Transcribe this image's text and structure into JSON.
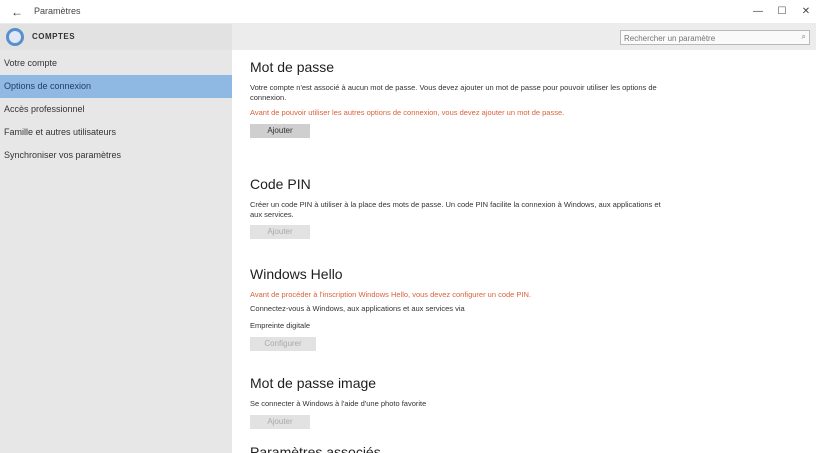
{
  "window": {
    "title": "Paramètres",
    "back_glyph": "←",
    "min_glyph": "—",
    "max_glyph": "☐",
    "close_glyph": "✕"
  },
  "header": {
    "section_title": "COMPTES",
    "icon": "gear-icon",
    "accent_color": "#5a8fcf"
  },
  "search": {
    "placeholder": "Rechercher un paramètre",
    "icon": "search-icon",
    "glyph": "⌕"
  },
  "sidebar": {
    "items": [
      {
        "label": "Votre compte",
        "active": false
      },
      {
        "label": "Options de connexion",
        "active": true
      },
      {
        "label": "Accès professionnel",
        "active": false
      },
      {
        "label": "Famille et autres utilisateurs",
        "active": false
      },
      {
        "label": "Synchroniser vos paramètres",
        "active": false
      }
    ]
  },
  "main": {
    "password": {
      "title": "Mot de passe",
      "text": "Votre compte n'est associé à aucun mot de passe. Vous devez ajouter un mot de passe pour pouvoir utiliser les options de connexion.",
      "warning": "Avant de pouvoir utiliser les autres options de connexion, vous devez ajouter un mot de passe.",
      "button": "Ajouter"
    },
    "pin": {
      "title": "Code PIN",
      "text": "Créer un code PIN à utiliser à la place des mots de passe. Un code PIN facilite la connexion à Windows, aux applications et aux services.",
      "button": "Ajouter"
    },
    "hello": {
      "title": "Windows Hello",
      "warning": "Avant de procéder à l'inscription Windows Hello, vous devez configurer un code PIN.",
      "text": "Connectez-vous à Windows, aux applications et aux services via",
      "sub": "Empreinte digitale",
      "button": "Configurer"
    },
    "picture": {
      "title": "Mot de passe image",
      "text": "Se connecter à Windows à l'aide d'une photo favorite",
      "button": "Ajouter"
    },
    "partial": {
      "title": "Paramètres associés"
    }
  },
  "colors": {
    "sidebar_bg": "#e7e7e7",
    "active_item": "#8fb8e3",
    "warning": "#d9613a"
  }
}
